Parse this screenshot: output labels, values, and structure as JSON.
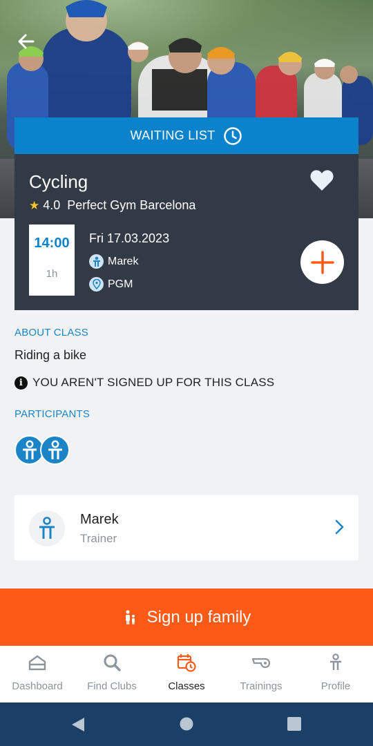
{
  "colors": {
    "accent": "#0b82cc",
    "orange": "#fe5a17",
    "card": "#323a45",
    "navbar": "#1b3f66"
  },
  "class": {
    "status_label": "WAITING LIST",
    "status_icon": "clock-icon",
    "title": "Cycling",
    "rating": "4.0",
    "club": "Perfect Gym Barcelona",
    "time": "14:00",
    "duration": "1h",
    "date": "Fri 17.03.2023",
    "trainer": "Marek",
    "location": "PGM",
    "favorite_icon": "heart-icon",
    "add_icon": "plus-icon"
  },
  "about": {
    "heading": "ABOUT CLASS",
    "text": "Riding a bike",
    "notice": "YOU AREN'T SIGNED UP FOR THIS CLASS"
  },
  "participants": {
    "heading": "PARTICIPANTS",
    "count": 2
  },
  "trainer_card": {
    "name": "Marek",
    "role": "Trainer"
  },
  "signup": {
    "label": "Sign up family"
  },
  "tabs": [
    {
      "label": "Dashboard",
      "icon": "home-icon",
      "active": false
    },
    {
      "label": "Find Clubs",
      "icon": "search-icon",
      "active": false
    },
    {
      "label": "Classes",
      "icon": "calendar-clock-icon",
      "active": true
    },
    {
      "label": "Trainings",
      "icon": "whistle-icon",
      "active": false
    },
    {
      "label": "Profile",
      "icon": "person-icon",
      "active": false
    }
  ]
}
